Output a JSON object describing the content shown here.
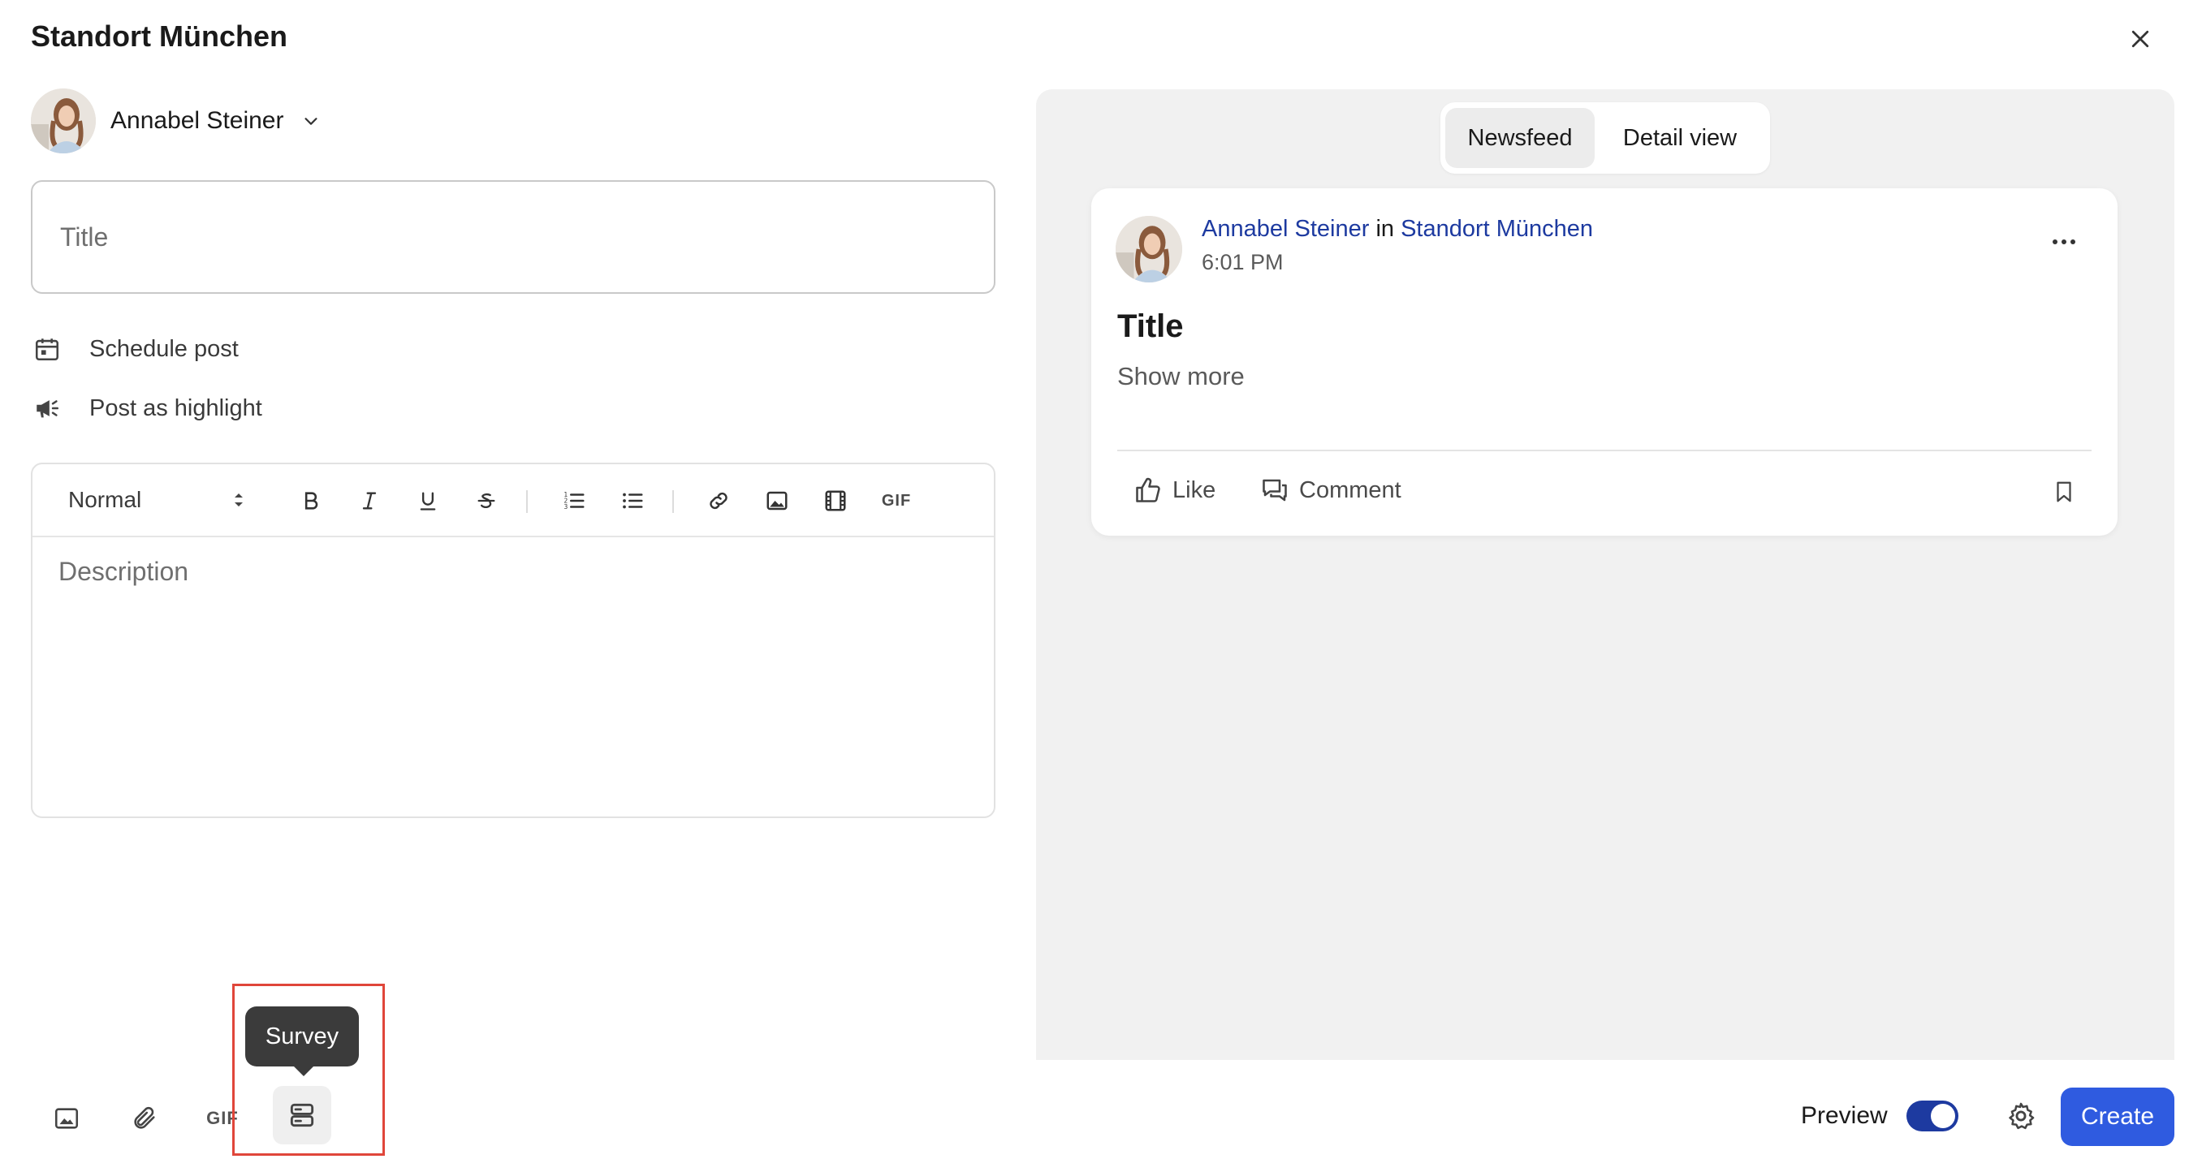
{
  "header": {
    "title": "Standort München",
    "close_icon": "close-icon"
  },
  "author": {
    "name": "Annabel Steiner",
    "avatar_icon": "avatar",
    "chevron_icon": "chevron-down-icon"
  },
  "form": {
    "title_placeholder": "Title",
    "schedule_label": "Schedule post",
    "schedule_icon": "calendar-icon",
    "highlight_label": "Post as highlight",
    "highlight_icon": "megaphone-icon"
  },
  "editor": {
    "format_value": "Normal",
    "toolbar_icons": [
      "bold-icon",
      "italic-icon",
      "underline-icon",
      "strikethrough-icon",
      "ordered-list-icon",
      "bullet-list-icon",
      "link-icon",
      "image-icon",
      "video-icon",
      "gif-icon"
    ],
    "gif_label": "GIF",
    "description_placeholder": "Description"
  },
  "attachments": {
    "icons": [
      "image-icon",
      "paperclip-icon",
      "gif-icon",
      "survey-icon"
    ],
    "gif_label": "GIF",
    "tooltip": "Survey"
  },
  "preview": {
    "tabs": [
      {
        "label": "Newsfeed",
        "active": true
      },
      {
        "label": "Detail view",
        "active": false
      }
    ],
    "card": {
      "author": "Annabel Steiner",
      "in_word": "in",
      "location": "Standort München",
      "time": "6:01 PM",
      "title": "Title",
      "show_more": "Show more",
      "like_label": "Like",
      "comment_label": "Comment"
    }
  },
  "footer": {
    "preview_label": "Preview",
    "preview_on": true,
    "create_label": "Create"
  },
  "colors": {
    "accent": "#2f5be0",
    "link": "#1d3aa0",
    "toggle": "#1d3aa0",
    "highlight_box": "#e0463a"
  }
}
